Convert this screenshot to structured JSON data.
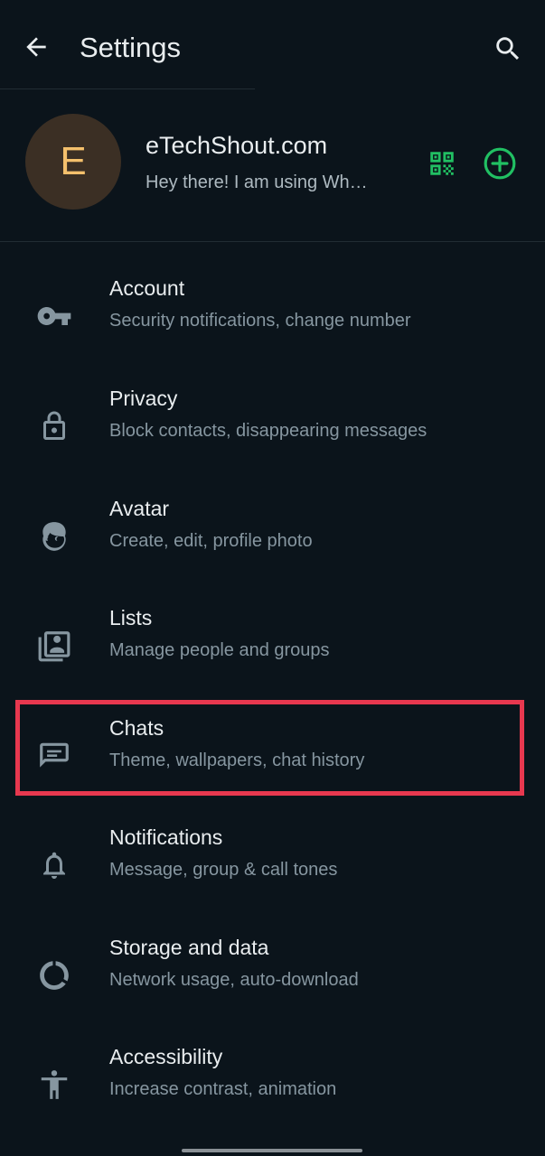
{
  "header": {
    "title": "Settings"
  },
  "profile": {
    "avatar_initial": "E",
    "name": "eTechShout.com",
    "status": "Hey there! I am using WhatsApp."
  },
  "settings": [
    {
      "label": "Account",
      "sub": "Security notifications, change number",
      "icon": "key-icon"
    },
    {
      "label": "Privacy",
      "sub": "Block contacts, disappearing messages",
      "icon": "lock-icon"
    },
    {
      "label": "Avatar",
      "sub": "Create, edit, profile photo",
      "icon": "avatar-face-icon"
    },
    {
      "label": "Lists",
      "sub": "Manage people and groups",
      "icon": "contact-list-icon"
    },
    {
      "label": "Chats",
      "sub": "Theme, wallpapers, chat history",
      "icon": "chat-message-icon"
    },
    {
      "label": "Notifications",
      "sub": "Message, group & call tones",
      "icon": "bell-icon"
    },
    {
      "label": "Storage and data",
      "sub": "Network usage, auto-download",
      "icon": "data-usage-icon"
    },
    {
      "label": "Accessibility",
      "sub": "Increase contrast, animation",
      "icon": "accessibility-icon"
    }
  ],
  "colors": {
    "background": "#0b141b",
    "accent": "#21c063",
    "highlight": "#e8384f",
    "avatar_bg": "#3b2f24",
    "avatar_text": "#f4c06c"
  }
}
